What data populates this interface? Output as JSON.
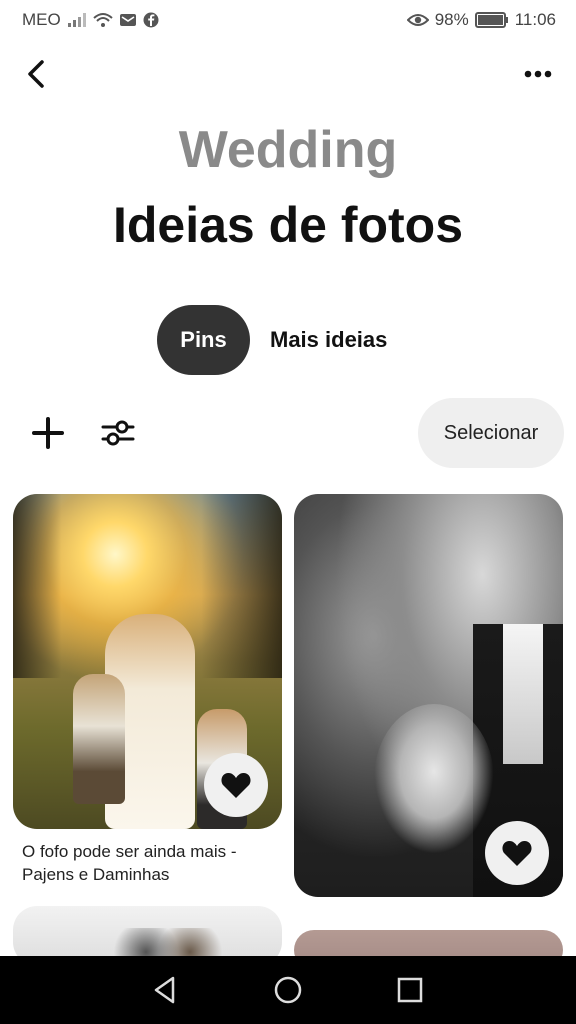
{
  "status_bar": {
    "carrier": "MEO",
    "battery_percent": "98%",
    "time": "11:06"
  },
  "header": {
    "board_title": "Wedding",
    "section_title": "Ideias de fotos"
  },
  "tabs": [
    {
      "label": "Pins",
      "active": true
    },
    {
      "label": "Mais ideias",
      "active": false
    }
  ],
  "toolbar": {
    "select_label": "Selecionar"
  },
  "pins": [
    {
      "caption": "O fofo pode ser ainda mais - Pajens e Daminhas"
    },
    {
      "caption": ""
    }
  ],
  "colors": {
    "active_tab_bg": "#333333",
    "select_btn_bg": "#efefef",
    "board_title": "#8a8a8a"
  }
}
